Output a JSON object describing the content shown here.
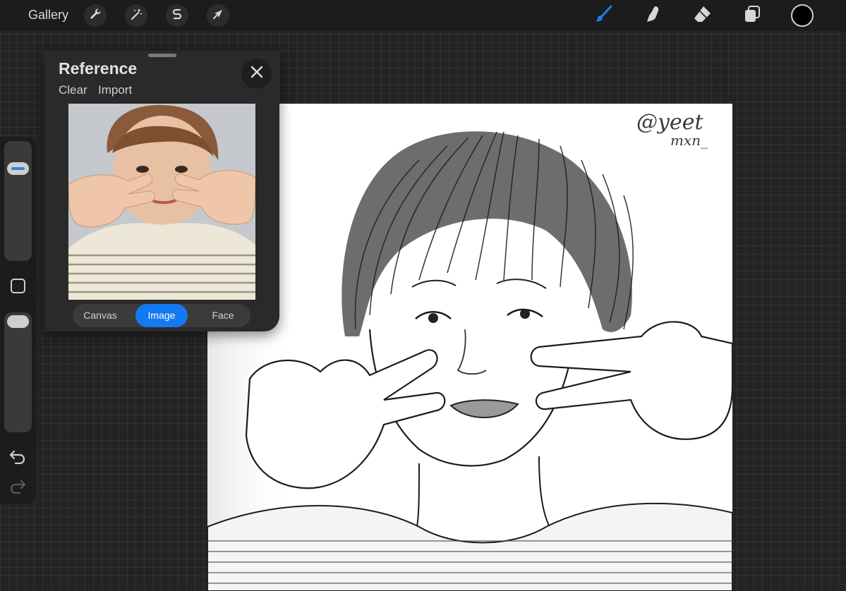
{
  "toolbar": {
    "gallery_label": "Gallery",
    "left_tools": [
      {
        "name": "actions",
        "icon": "wrench-icon"
      },
      {
        "name": "adjustments",
        "icon": "magic-wand-icon"
      },
      {
        "name": "selection",
        "icon": "selection-s-icon"
      },
      {
        "name": "transform",
        "icon": "arrow-cursor-icon"
      }
    ],
    "right_tools": [
      {
        "name": "paint",
        "icon": "brush-icon",
        "active": true
      },
      {
        "name": "smudge",
        "icon": "smudge-finger-icon"
      },
      {
        "name": "erase",
        "icon": "eraser-icon"
      },
      {
        "name": "layers",
        "icon": "layers-icon"
      }
    ],
    "active_color": "#000000",
    "accent_color": "#1d7ef0"
  },
  "sidebar": {
    "brush_size_level": 0.82,
    "opacity_level": 1.0,
    "modify_icon": "square-outline-icon",
    "undo_icon": "undo-arrow-icon",
    "redo_icon": "redo-arrow-icon"
  },
  "reference_panel": {
    "title": "Reference",
    "actions": {
      "clear": "Clear",
      "import": "Import"
    },
    "close_icon": "close-x-icon",
    "modes": [
      "Canvas",
      "Image",
      "Face"
    ],
    "selected_mode": "Image",
    "photo": "reference photo of a person making peace signs next to cheeks"
  },
  "canvas": {
    "signature_line1": "@yeet",
    "signature_line2": "mxn_",
    "drawing": "pencil sketch of a person making peace signs next to cheeks"
  }
}
